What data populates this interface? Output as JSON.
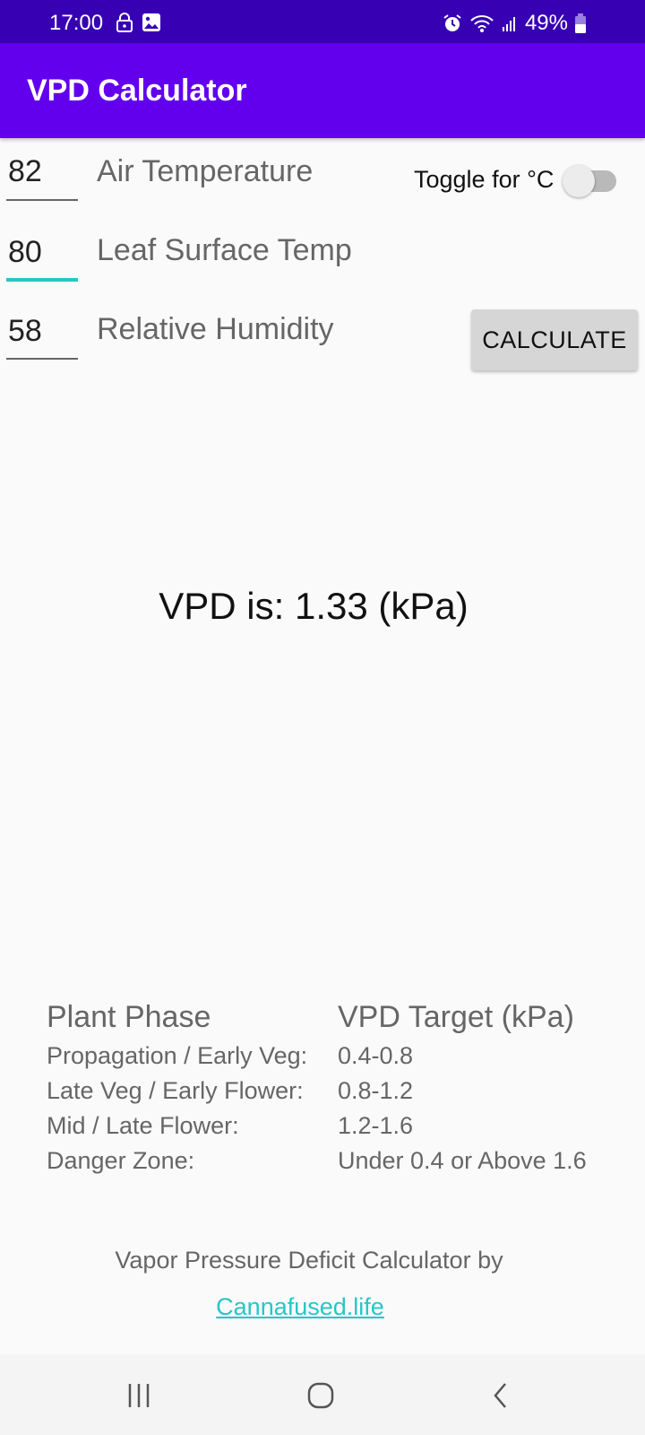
{
  "status_bar": {
    "time": "17:00",
    "left_icons": [
      "lock-icon",
      "image-icon"
    ],
    "right_icons": [
      "alarm-icon",
      "wifi-icon",
      "signal-icon"
    ],
    "battery": "49%"
  },
  "app_bar": {
    "title": "VPD Calculator"
  },
  "inputs": [
    {
      "value": "82",
      "label": "Air Temperature",
      "focused": false
    },
    {
      "value": "80",
      "label": "Leaf Surface Temp",
      "focused": true
    },
    {
      "value": "58",
      "label": "Relative Humidity",
      "focused": false
    }
  ],
  "toggle": {
    "label": "Toggle for °C",
    "checked": false
  },
  "calculate_button": {
    "label": "CALCULATE"
  },
  "result": {
    "text": "VPD is: 1.33 (kPa)"
  },
  "phase_table": {
    "headers": [
      "Plant Phase",
      "VPD Target (kPa)"
    ],
    "rows": [
      [
        "Propagation / Early Veg:",
        "0.4-0.8"
      ],
      [
        "Late Veg / Early Flower:",
        "0.8-1.2"
      ],
      [
        "Mid / Late Flower:",
        "1.2-1.6"
      ],
      [
        "Danger Zone:",
        "Under 0.4 or Above 1.6"
      ]
    ]
  },
  "footer": {
    "credit": "Vapor Pressure Deficit Calculator by",
    "link": "Cannafused.life"
  },
  "nav_bar": {
    "buttons": [
      "recent-apps",
      "home",
      "back"
    ]
  },
  "colors": {
    "primary": "#6200ee",
    "primary_dark": "#3700b3",
    "accent": "#26c6c6"
  }
}
